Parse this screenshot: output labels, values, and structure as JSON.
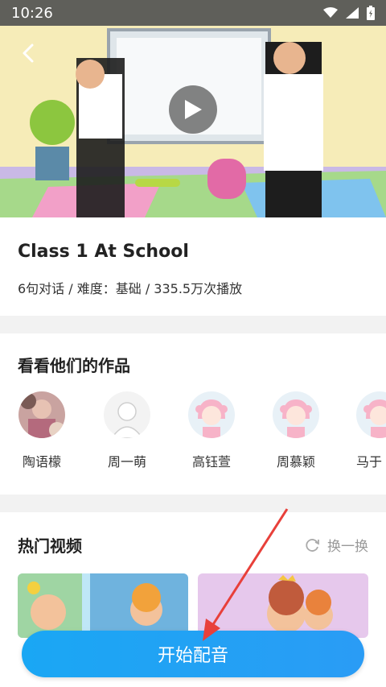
{
  "status_bar": {
    "time": "10:26"
  },
  "video": {
    "icons": [
      "back-chevron-icon",
      "play-icon"
    ]
  },
  "course": {
    "title": "Class 1 At School",
    "meta": "6句对话 / 难度：基础 / 335.5万次播放"
  },
  "works": {
    "title": "看看他们的作品",
    "users": [
      {
        "name": "陶语檬",
        "avatar": "photo-avatar"
      },
      {
        "name": "周一萌",
        "avatar": "default-avatar"
      },
      {
        "name": "高钰萱",
        "avatar": "cartoon-girl-avatar"
      },
      {
        "name": "周慕颖",
        "avatar": "cartoon-girl-avatar"
      },
      {
        "name": "马于",
        "avatar": "cartoon-girl-avatar"
      }
    ]
  },
  "hot": {
    "title": "热门视频",
    "refresh_label": "换一换"
  },
  "cta": {
    "label": "开始配音"
  },
  "colors": {
    "accent": "#1aa7f4",
    "annotation": "#e8403a"
  }
}
